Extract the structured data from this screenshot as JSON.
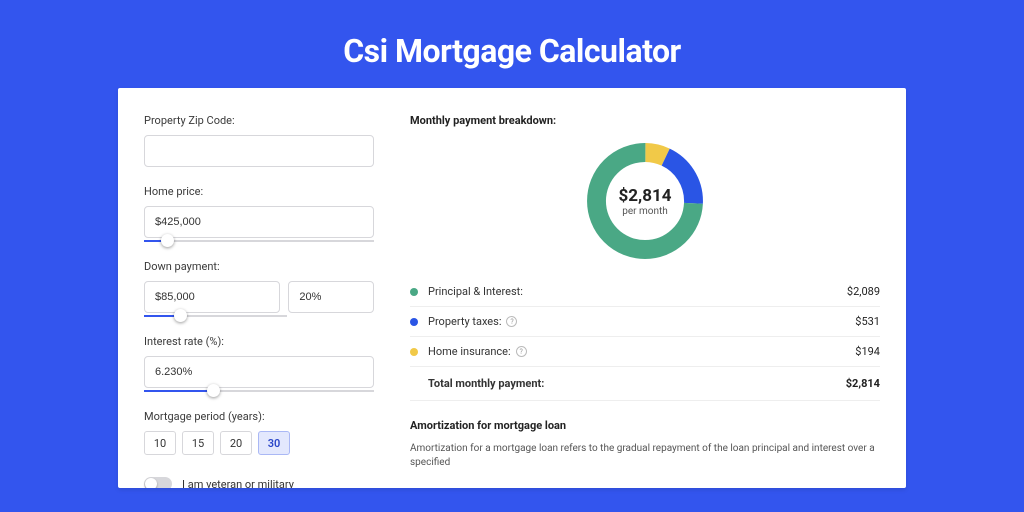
{
  "page_title": "Csi Mortgage Calculator",
  "colors": {
    "primary": "#3355ee",
    "green": "#4aa885",
    "blue": "#2a55e5",
    "yellow": "#f1c948"
  },
  "form": {
    "zip_label": "Property Zip Code:",
    "zip_value": "",
    "home_price_label": "Home price:",
    "home_price_value": "$425,000",
    "down_payment_label": "Down payment:",
    "down_payment_value": "$85,000",
    "down_payment_pct": "20%",
    "interest_label": "Interest rate (%):",
    "interest_value": "6.230%",
    "period_label": "Mortgage period (years):",
    "period_options": [
      "10",
      "15",
      "20",
      "30"
    ],
    "period_selected": "30",
    "veteran_label": "I am veteran or military",
    "home_price_slider_pct": 10,
    "down_payment_slider_pct": 25,
    "interest_slider_pct": 30
  },
  "breakdown": {
    "title": "Monthly payment breakdown:",
    "total_value": "$2,814",
    "total_sub": "per month",
    "items": [
      {
        "label": "Principal & Interest:",
        "value": "$2,089",
        "color": "#4aa885",
        "has_info": false
      },
      {
        "label": "Property taxes:",
        "value": "$531",
        "color": "#2a55e5",
        "has_info": true
      },
      {
        "label": "Home insurance:",
        "value": "$194",
        "color": "#f1c948",
        "has_info": true
      }
    ],
    "total_row_label": "Total monthly payment:",
    "total_row_value": "$2,814"
  },
  "amortization": {
    "title": "Amortization for mortgage loan",
    "text": "Amortization for a mortgage loan refers to the gradual repayment of the loan principal and interest over a specified"
  },
  "chart_data": {
    "type": "pie",
    "title": "Monthly payment breakdown",
    "series": [
      {
        "name": "Principal & Interest",
        "value": 2089,
        "color": "#4aa885"
      },
      {
        "name": "Property taxes",
        "value": 531,
        "color": "#2a55e5"
      },
      {
        "name": "Home insurance",
        "value": 194,
        "color": "#f1c948"
      }
    ],
    "total": 2814,
    "unit": "USD per month"
  }
}
